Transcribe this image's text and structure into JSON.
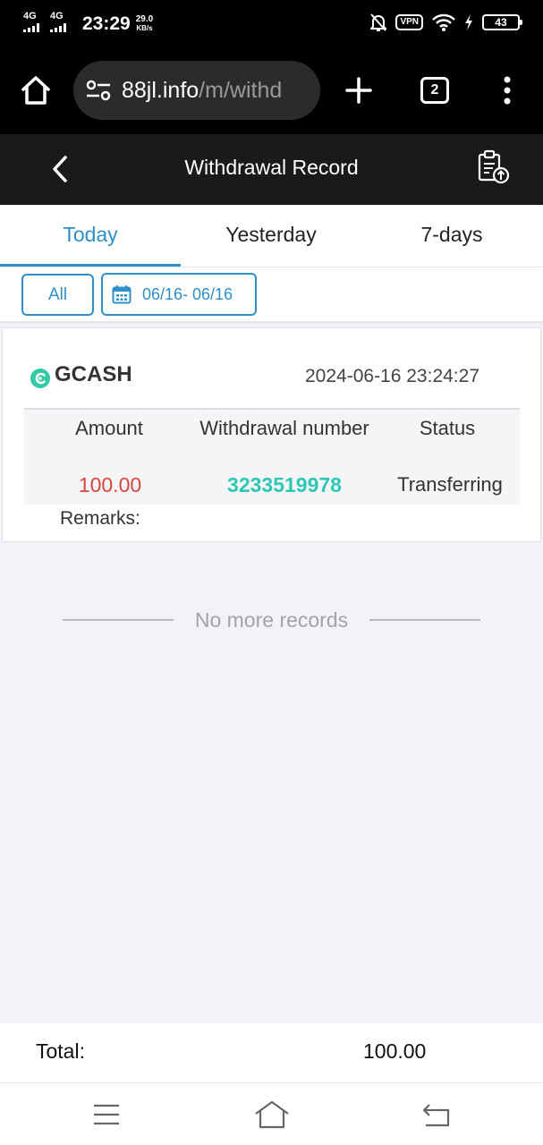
{
  "status_bar": {
    "network1": "4G",
    "network2": "4G",
    "time": "23:29",
    "speed_value": "29.0",
    "speed_unit": "KB/s",
    "vpn_label": "VPN",
    "battery": "43"
  },
  "browser": {
    "url_host": "88jl.info",
    "url_path": "/m/withd",
    "tab_count": "2"
  },
  "header": {
    "title": "Withdrawal Record"
  },
  "tabs": [
    {
      "label": "Today",
      "active": true
    },
    {
      "label": "Yesterday",
      "active": false
    },
    {
      "label": "7-days",
      "active": false
    }
  ],
  "filters": {
    "type_label": "All",
    "date_range": "06/16- 06/16"
  },
  "record": {
    "method": "GCASH",
    "datetime": "2024-06-16 23:24:27",
    "headers": {
      "amount": "Amount",
      "number": "Withdrawal number",
      "status": "Status"
    },
    "amount": "100.00",
    "number": "3233519978",
    "status": "Transferring",
    "remarks_label": "Remarks",
    "remarks_sep": ":"
  },
  "list_end": "No more records",
  "total": {
    "label": "Total:",
    "value": "100.00"
  },
  "colors": {
    "accent": "#2f8fc8",
    "amount": "#d8473c",
    "number": "#2ec7b3",
    "header_bg": "#1a1a1a",
    "page_bg": "#f2f2f8"
  }
}
